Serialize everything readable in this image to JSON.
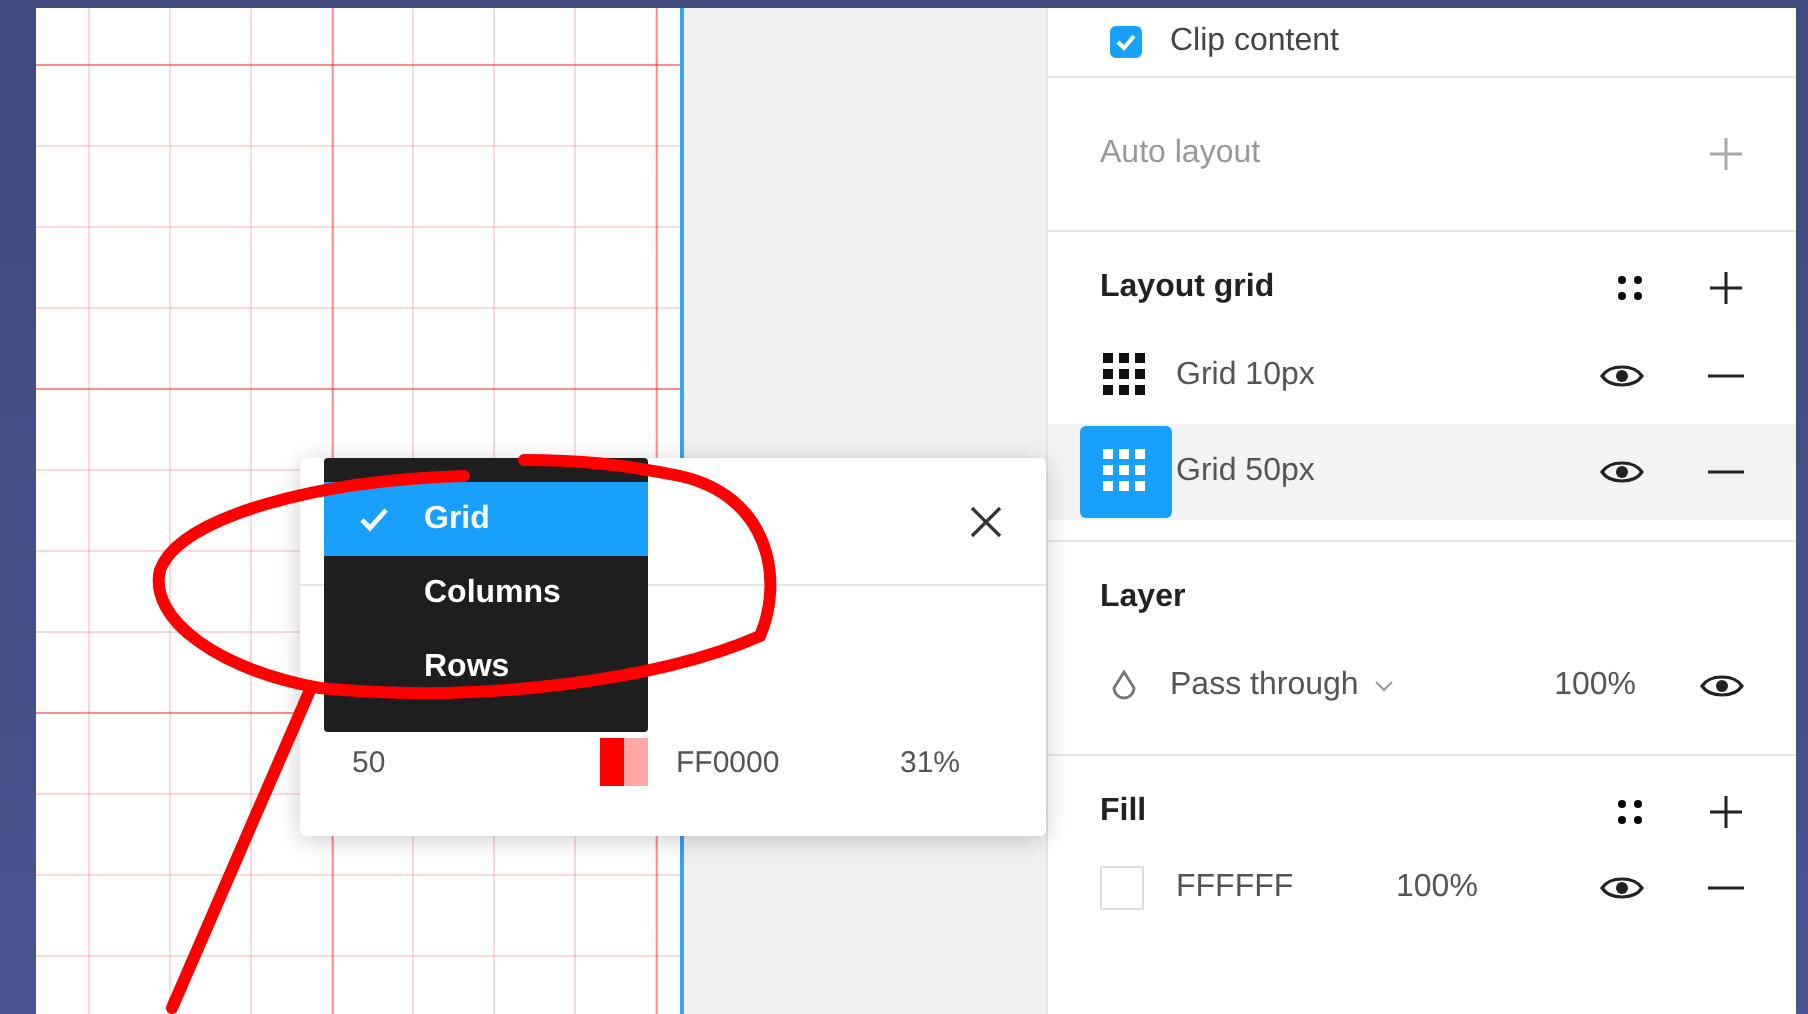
{
  "panel": {
    "clip_content": {
      "label": "Clip content",
      "checked": true
    },
    "auto_layout": {
      "title": "Auto layout"
    },
    "layout_grid": {
      "title": "Layout grid",
      "items": [
        {
          "label": "Grid 10px",
          "selected": false
        },
        {
          "label": "Grid 50px",
          "selected": true
        }
      ]
    },
    "layer": {
      "title": "Layer",
      "blend_mode": "Pass through",
      "opacity": "100%"
    },
    "fill": {
      "title": "Fill",
      "items": [
        {
          "hex": "FFFFFF",
          "opacity": "100%"
        }
      ]
    }
  },
  "grid_settings": {
    "size": "50",
    "color_hex": "FF0000",
    "opacity": "31%",
    "type_menu": [
      {
        "label": "Grid",
        "selected": true
      },
      {
        "label": "Columns",
        "selected": false
      },
      {
        "label": "Rows",
        "selected": false
      }
    ]
  }
}
